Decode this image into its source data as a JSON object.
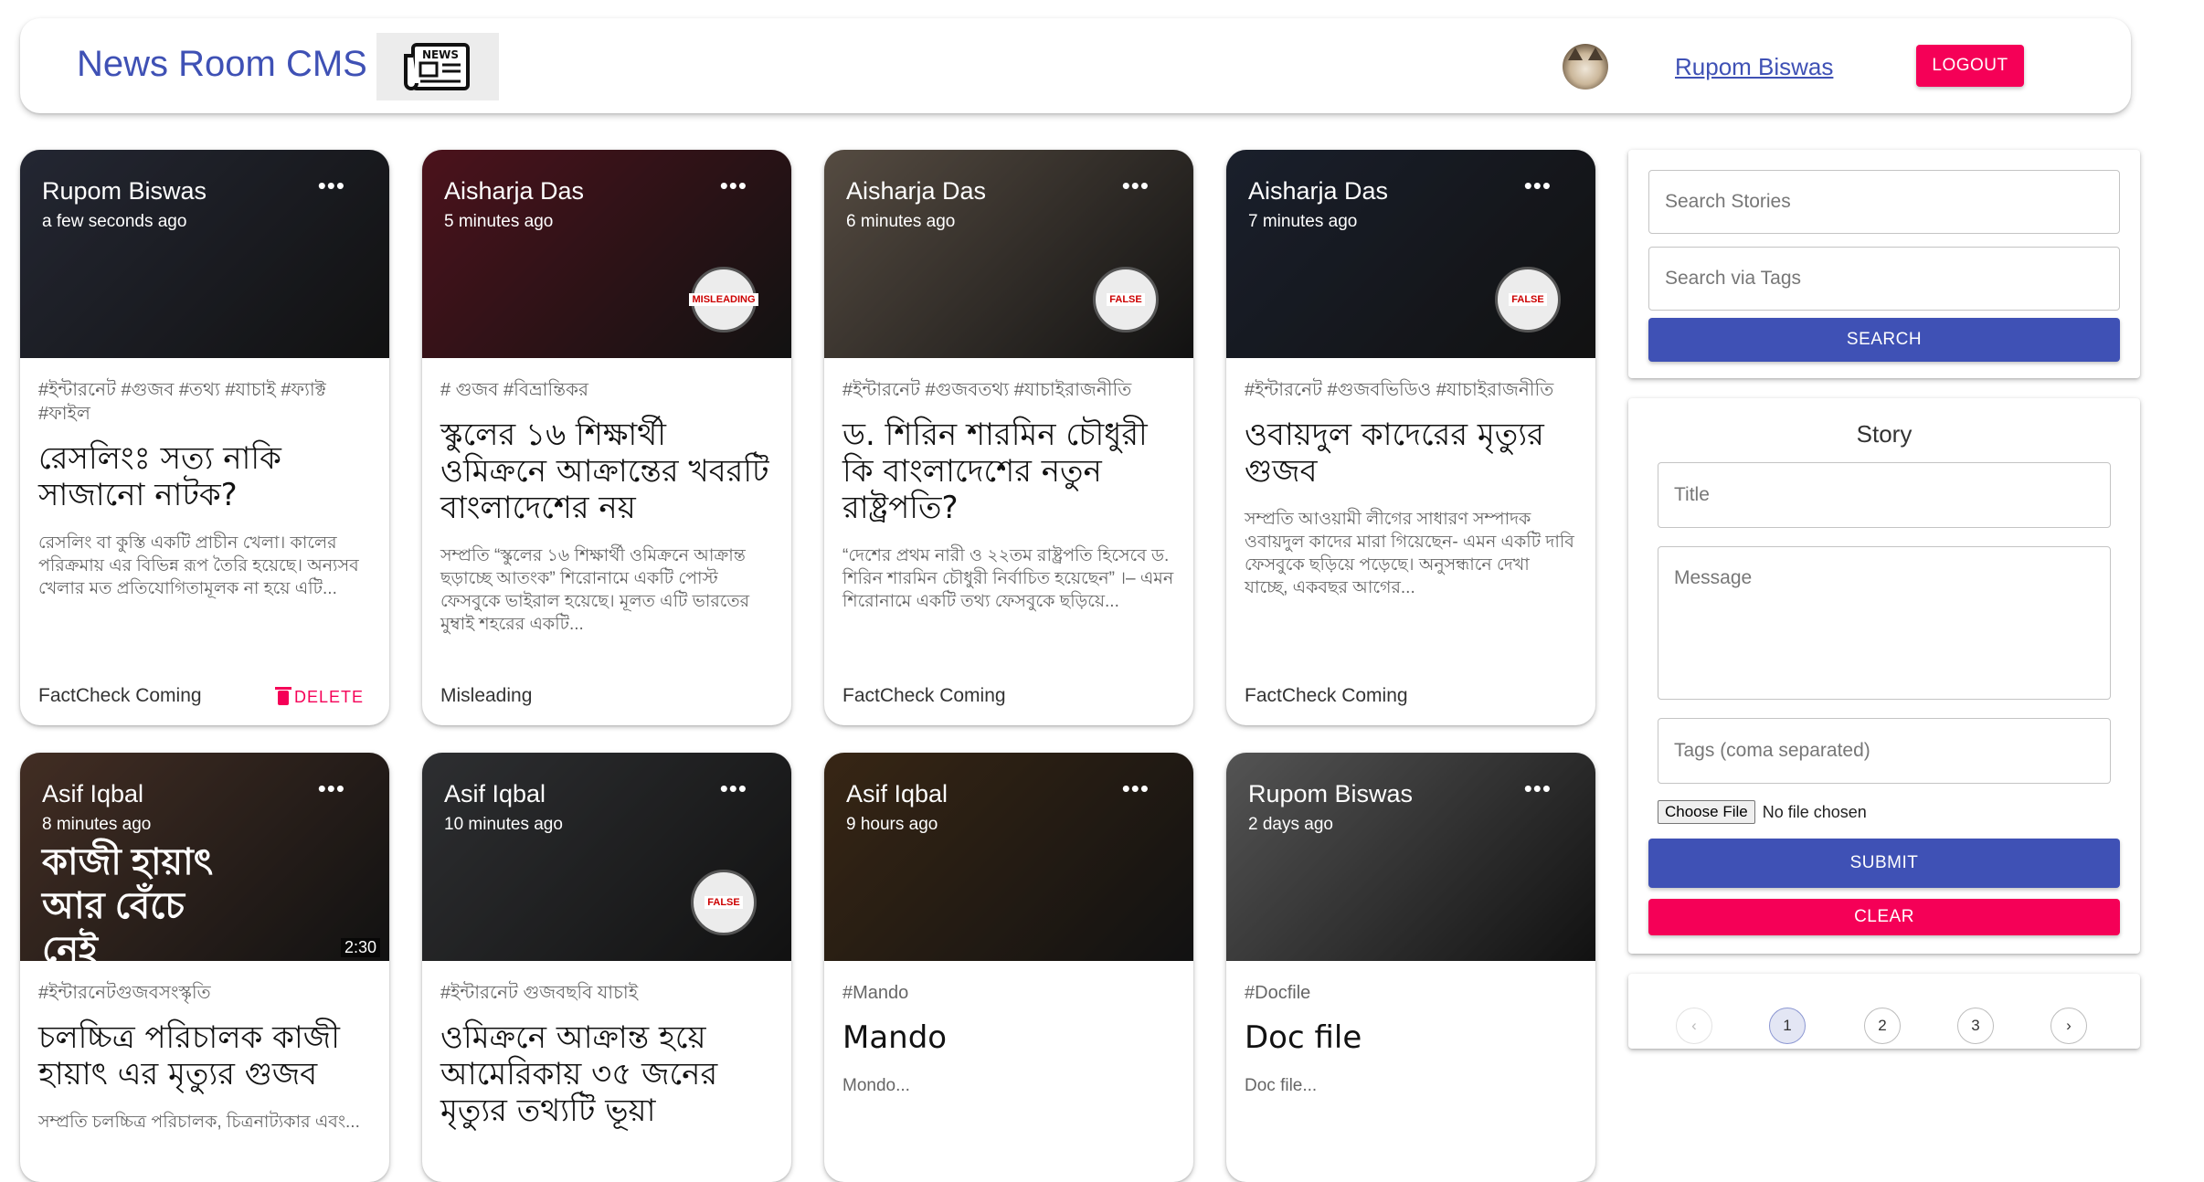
{
  "appbar": {
    "title": "News Room CMS",
    "logo_text": "NEWS",
    "user_name": "Rupom Biswas",
    "logout_label": "LOGOUT"
  },
  "posts": [
    {
      "author": "Rupom Biswas",
      "time": "a few seconds ago",
      "tags": "#ইন্টারনেট #গুজব #তথ্য #যাচাই #ফ্যাক্ট #ফাইল",
      "title": "রেসলিংঃ সত্য নাকি সাজানো নাটক?",
      "message": "রেসলিং বা কুস্তি একটি প্রাচীন খেলা। কালের পরিক্রমায় এর বিভিন্ন রূপ তৈরি হয়েছে। অন্যসব খেলার মত প্রতিযোগিতামূলক না হয়ে এটি...",
      "status": "FactCheck Coming",
      "delete_label": "DELETE",
      "image_color": "#3a3f52",
      "has_badge": false
    },
    {
      "author": "Aisharja Das",
      "time": "5 minutes ago",
      "tags": "# গুজব #বিভ্রান্তিকর",
      "title": "স্কুলের ১৬ শিক্ষার্থী ওমিক্রনে আক্রান্তের খবরটি বাংলাদেশের নয়",
      "message": "সম্প্রতি “স্কুলের ১৬ শিক্ষার্থী ওমিক্রনে আক্রান্ত ছড়াচ্ছে আতংক” শিরোনামে একটি পোস্ট ফেসবুকে ভাইরাল হয়েছে। মূলত এটি ভারতের মুম্বাই শহরের একটি...",
      "status": "Misleading",
      "image_color": "#7a1e2e",
      "has_badge": true,
      "badge_text": "MISLEADING"
    },
    {
      "author": "Aisharja Das",
      "time": "6 minutes ago",
      "tags": "#ইন্টারনেট #গুজবতথ্য #যাচাইরাজনীতি",
      "title": "ড. শিরিন শারমিন চৌধুরী কি বাংলাদেশের নতুন রাষ্ট্রপতি?",
      "message": "“দেশের প্রথম নারী ও ২২তম রাষ্ট্রপতি হিসেবে ড. শিরিন শারমিন চৌধুরী নির্বাচিত হয়েছেন” ।– এমন শিরোনামে একটি তথ্য ফেসবুকে ছড়িয়ে...",
      "status": "FactCheck Coming",
      "image_color": "#8a7a6a",
      "has_badge": true,
      "badge_text": "FALSE"
    },
    {
      "author": "Aisharja Das",
      "time": "7 minutes ago",
      "tags": "#ইন্টারনেট #গুজবভিডিও #যাচাইরাজনীতি",
      "title": "ওবায়দুল কাদেরের মৃত্যুর গুজব",
      "message": "সম্প্রতি আওয়ামী লীগের সাধারণ সম্পাদক ওবায়দুল কাদের মারা গিয়েছেন- এমন একটি দাবি ফেসবুকে ছড়িয়ে পড়েছে। অনুসন্ধানে দেখা যাচ্ছে, একবছর আগের...",
      "status": "FactCheck Coming",
      "image_color": "#2a3347",
      "has_badge": true,
      "badge_text": "FALSE"
    },
    {
      "author": "Asif Iqbal",
      "time": "8 minutes ago",
      "tags": "#ইন্টারনেটগুজবসংস্কৃতি",
      "title": "চলচ্চিত্র পরিচালক কাজী হায়াৎ এর মৃত্যুর গুজব",
      "message": "সম্প্রতি চলচ্চিত্র পরিচালক, চিত্রনাট্যকার এবং...",
      "image_color": "#6b4a3a",
      "has_badge": false,
      "overlay_text": "কাজী হায়াৎ আর বেঁচে নেই",
      "duration": "2:30"
    },
    {
      "author": "Asif Iqbal",
      "time": "10 minutes ago",
      "tags": "#ইন্টারনেট গুজবছবি যাচাই",
      "title": "ওমিক্রনে আক্রান্ত হয়ে আমেরিকায় ৩৫ জনের মৃত্যুর তথ্যটি ভূয়া",
      "message": "",
      "image_color": "#4a4c50",
      "has_badge": true,
      "badge_text": "FALSE"
    },
    {
      "author": "Asif Iqbal",
      "time": "9 hours ago",
      "tags": "#Mando",
      "title": "Mando",
      "message": "Mondo...",
      "image_color": "#5a3e22",
      "has_badge": false
    },
    {
      "author": "Rupom Biswas",
      "time": "2 days ago",
      "tags": "#Docfile",
      "title": "Doc file",
      "message": "Doc file...",
      "image_color": "#888888",
      "has_badge": false
    }
  ],
  "search": {
    "stories_placeholder": "Search Stories",
    "tags_placeholder": "Search via Tags",
    "button_label": "SEARCH"
  },
  "story_form": {
    "heading": "Story",
    "title_placeholder": "Title",
    "message_placeholder": "Message",
    "tags_placeholder": "Tags (coma separated)",
    "file_button": "Choose File",
    "file_status": "No file chosen",
    "submit_label": "SUBMIT",
    "clear_label": "CLEAR"
  },
  "pagination": {
    "prev_icon": "‹",
    "pages": [
      "1",
      "2",
      "3"
    ],
    "current_page": "1",
    "next_icon": "›"
  },
  "colors": {
    "primary": "#3f51b5",
    "secondary": "#f50057"
  }
}
